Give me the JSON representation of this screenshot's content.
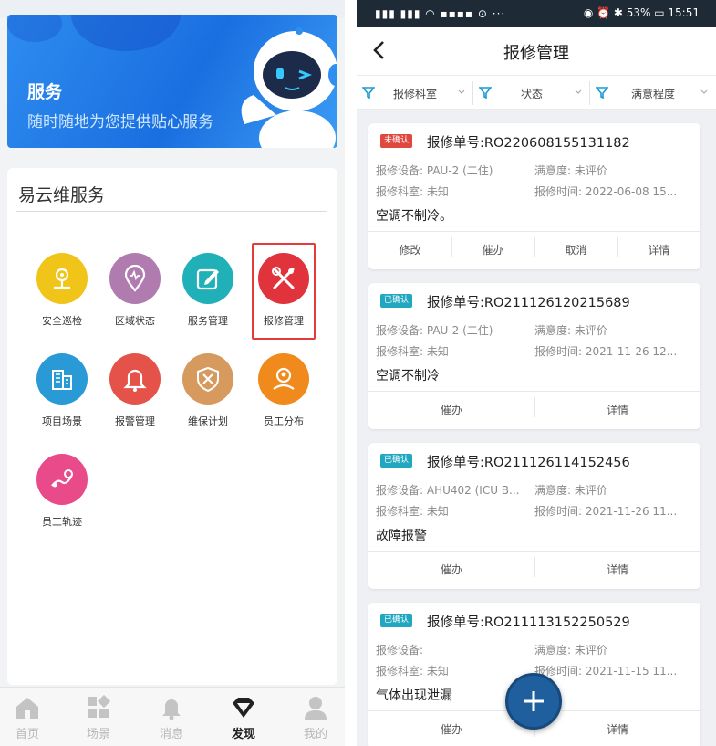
{
  "left": {
    "banner": {
      "title": "服务",
      "subtitle": "随时随地为您提供贴心服务"
    },
    "services": {
      "title": "易云维服务",
      "items": [
        {
          "label": "安全巡检",
          "icon": "inspection-icon",
          "color": "#f0c419"
        },
        {
          "label": "区域状态",
          "icon": "location-status-icon",
          "color": "#b07cb0"
        },
        {
          "label": "服务管理",
          "icon": "edit-icon",
          "color": "#1fb0b8"
        },
        {
          "label": "报修管理",
          "icon": "tools-icon",
          "color": "#e0333b"
        },
        {
          "label": "项目场景",
          "icon": "buildings-icon",
          "color": "#2a9ad6"
        },
        {
          "label": "报警管理",
          "icon": "bell-icon",
          "color": "#e4524a"
        },
        {
          "label": "维保计划",
          "icon": "shield-tools-icon",
          "color": "#d69a5e"
        },
        {
          "label": "员工分布",
          "icon": "staff-map-icon",
          "color": "#f08a1c"
        },
        {
          "label": "员工轨迹",
          "icon": "track-icon",
          "color": "#e84a8a"
        }
      ]
    },
    "tabbar": [
      {
        "label": "首页",
        "icon": "home-icon"
      },
      {
        "label": "场景",
        "icon": "grid-icon"
      },
      {
        "label": "消息",
        "icon": "bell-icon"
      },
      {
        "label": "发现",
        "icon": "diamond-icon",
        "active": true
      },
      {
        "label": "我的",
        "icon": "person-icon"
      }
    ]
  },
  "right": {
    "status": {
      "battery": "53%",
      "time": "15:51"
    },
    "title": "报修管理",
    "filters": [
      "报修科室",
      "状态",
      "满意程度"
    ],
    "orders": [
      {
        "badge": "未确认",
        "order_no": "报修单号:RO220608155131182",
        "device_label": "报修设备:",
        "device": "PAU-2 (二住)",
        "satisfaction_label": "满意度:",
        "satisfaction": "未评价",
        "dept_label": "报修科室:",
        "dept": "未知",
        "time_label": "报修时间:",
        "time": "2022-06-08 15...",
        "desc": "空调不制冷。",
        "actions": [
          "修改",
          "催办",
          "取消",
          "详情"
        ]
      },
      {
        "badge": "已确认",
        "order_no": "报修单号:RO211126120215689",
        "device_label": "报修设备:",
        "device": "PAU-2 (二住)",
        "satisfaction_label": "满意度:",
        "satisfaction": "未评价",
        "dept_label": "报修科室:",
        "dept": "未知",
        "time_label": "报修时间:",
        "time": "2021-11-26 12...",
        "desc": "空调不制冷",
        "actions": [
          "催办",
          "详情"
        ]
      },
      {
        "badge": "已确认",
        "order_no": "报修单号:RO211126114152456",
        "device_label": "报修设备:",
        "device": "AHU402 (ICU B...",
        "satisfaction_label": "满意度:",
        "satisfaction": "未评价",
        "dept_label": "报修科室:",
        "dept": "未知",
        "time_label": "报修时间:",
        "time": "2021-11-26 11...",
        "desc": "故障报警",
        "actions": [
          "催办",
          "详情"
        ]
      },
      {
        "badge": "已确认",
        "order_no": "报修单号:RO211113152250529",
        "device_label": "报修设备:",
        "device": "",
        "satisfaction_label": "满意度:",
        "satisfaction": "未评价",
        "dept_label": "报修科室:",
        "dept": "未知",
        "time_label": "报修时间:",
        "time": "2021-11-15 11...",
        "desc": "气体出现泄漏",
        "actions": [
          "催办",
          "详情"
        ]
      }
    ]
  }
}
